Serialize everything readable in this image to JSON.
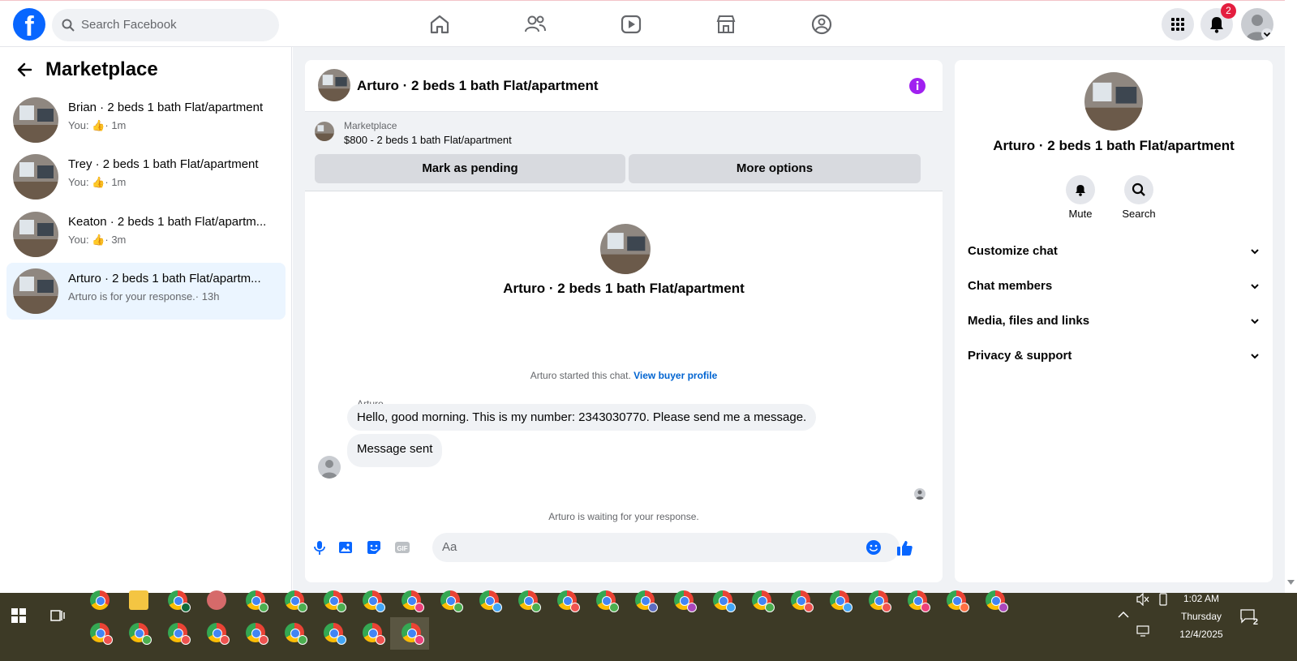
{
  "header": {
    "search_placeholder": "Search Facebook",
    "notifications_count": "2"
  },
  "sidebar": {
    "title": "Marketplace",
    "conversations": [
      {
        "name": "Brian · 2 beds 1 bath Flat/apartment",
        "prefix": "You:",
        "time": "· 1m"
      },
      {
        "name": "Trey · 2 beds 1 bath Flat/apartment",
        "prefix": "You:",
        "time": "· 1m"
      },
      {
        "name": "Keaton · 2 beds 1 bath Flat/apartm...",
        "prefix": "You:",
        "time": "· 3m"
      },
      {
        "name": "Arturo · 2 beds 1 bath Flat/apartm...",
        "prefix": "Arturo is for your response.",
        "time": "· 13h"
      }
    ]
  },
  "chat": {
    "title": "Arturo · 2 beds 1 bath Flat/apartment",
    "marketplace_label": "Marketplace",
    "listing": "$800 - 2 beds 1 bath Flat/apartment",
    "mark_pending": "Mark as pending",
    "more_options": "More options",
    "center_title": "Arturo · 2 beds 1 bath Flat/apartment",
    "started_text": "Arturo started this chat.",
    "view_profile": "View buyer profile",
    "sender": "Arturo",
    "messages": [
      "Hello, good morning. This is my number: 2343030770. Please send me a message.",
      "Message sent"
    ],
    "waiting": "Arturo is waiting for your response.",
    "composer_placeholder": "Aa"
  },
  "details": {
    "title": "Arturo · 2 beds 1 bath Flat/apartment",
    "mute": "Mute",
    "search": "Search",
    "sections": [
      "Customize chat",
      "Chat members",
      "Media, files and links",
      "Privacy & support"
    ]
  },
  "taskbar": {
    "time": "1:02 AM",
    "day": "Thursday",
    "date": "12/4/2025",
    "notif_count": "2"
  },
  "colors": {
    "brand": "#0866ff",
    "accent_purple": "#a020f0",
    "active_bg": "#ebf5ff"
  }
}
